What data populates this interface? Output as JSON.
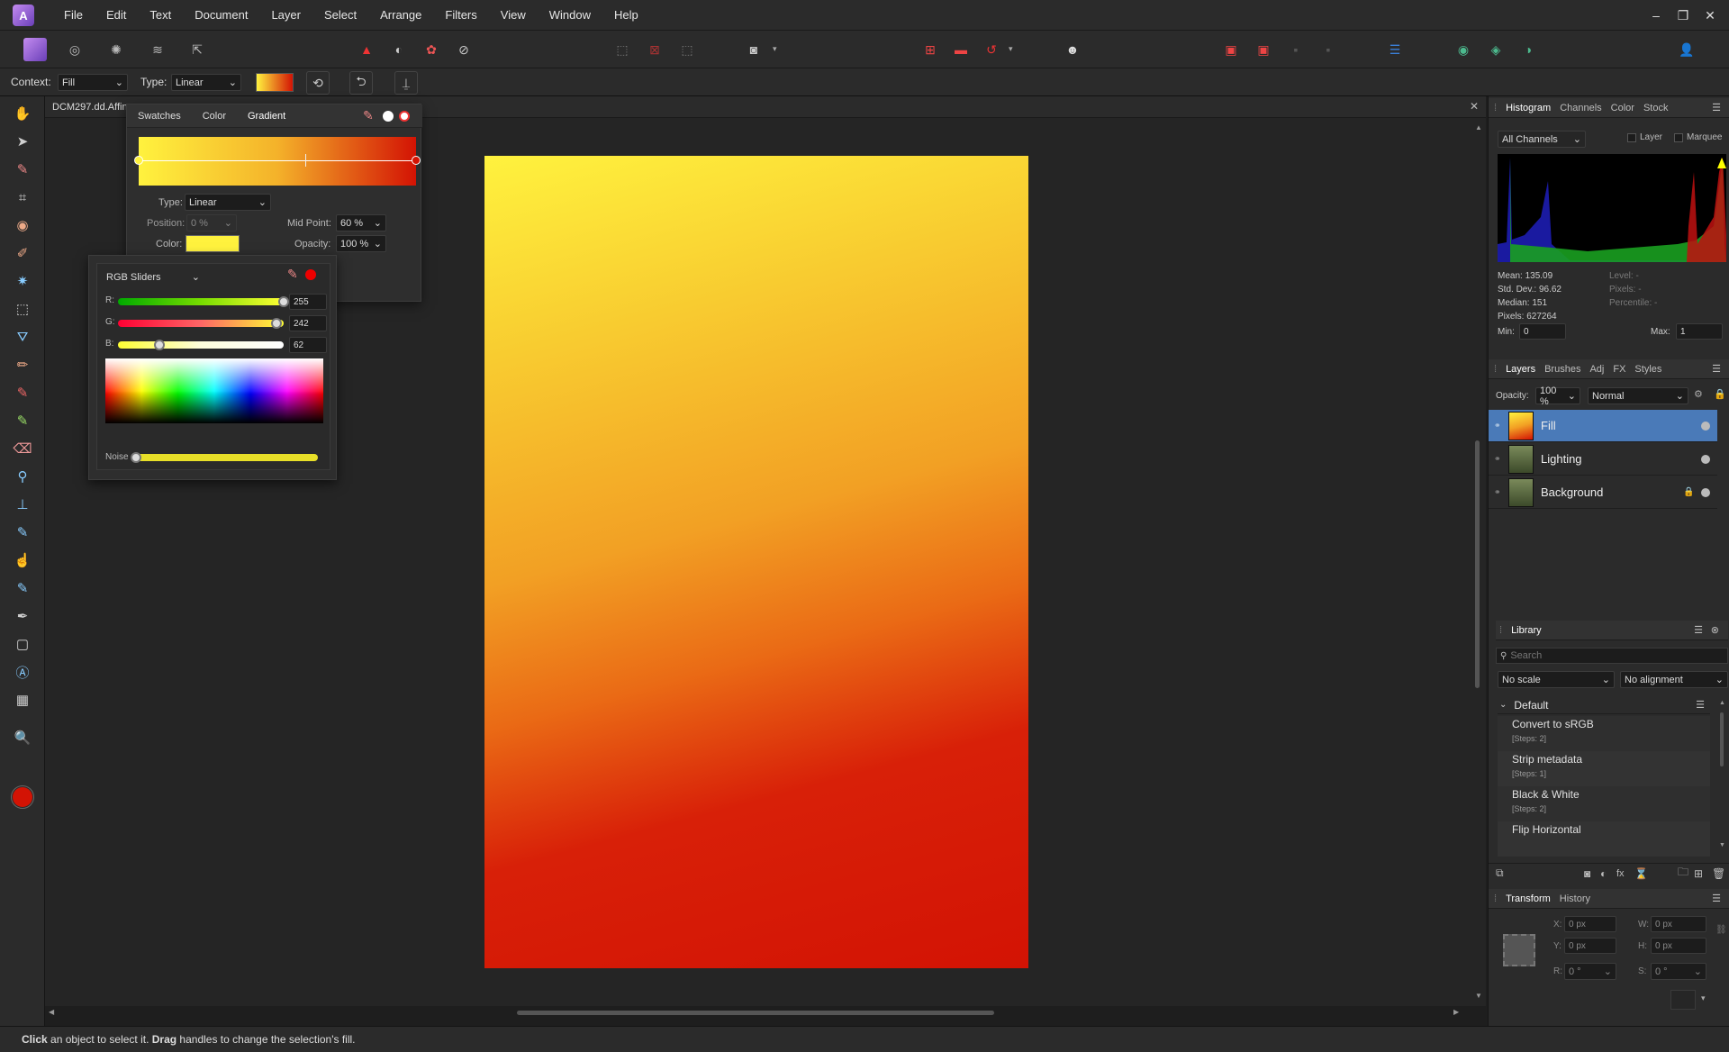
{
  "menubar": {
    "app_logo": "A",
    "items": [
      "File",
      "Edit",
      "Text",
      "Document",
      "Layer",
      "Select",
      "Arrange",
      "Filters",
      "View",
      "Window",
      "Help"
    ]
  },
  "context_bar": {
    "context_label": "Context:",
    "context_value": "Fill",
    "type_label": "Type:",
    "type_value": "Linear"
  },
  "document": {
    "tab_title": "DCM297.dd.Affin"
  },
  "gradient_popup": {
    "tabs": [
      "Swatches",
      "Color",
      "Gradient"
    ],
    "type_label": "Type:",
    "type_value": "Linear",
    "position_label": "Position:",
    "position_value": "0 %",
    "midpoint_label": "Mid Point:",
    "midpoint_value": "60 %",
    "color_label": "Color:",
    "opacity_label": "Opacity:",
    "opacity_value": "100 %",
    "color_swatch": "#fff23e"
  },
  "rgb_popup": {
    "mode": "RGB Sliders",
    "r_label": "R:",
    "r_value": "255",
    "g_label": "G:",
    "g_value": "242",
    "b_label": "B:",
    "b_value": "62",
    "noise_label": "Noise"
  },
  "histogram": {
    "tabs": [
      "Histogram",
      "Channels",
      "Color",
      "Stock"
    ],
    "channel": "All Channels",
    "layer_label": "Layer",
    "marquee_label": "Marquee",
    "mean": "Mean: 135.09",
    "stddev": "Std. Dev.: 96.62",
    "median": "Median: 151",
    "pixels": "Pixels: 627264",
    "level": "Level: -",
    "pixels_r": "Pixels: -",
    "percentile": "Percentile: -",
    "min_label": "Min:",
    "min_value": "0",
    "max_label": "Max:",
    "max_value": "1"
  },
  "layers": {
    "tabs": [
      "Layers",
      "Brushes",
      "Adj",
      "FX",
      "Styles"
    ],
    "opacity_label": "Opacity:",
    "opacity_value": "100 %",
    "blend_mode": "Normal",
    "items": [
      {
        "name": "Fill"
      },
      {
        "name": "Lighting"
      },
      {
        "name": "Background"
      }
    ]
  },
  "library": {
    "title": "Library",
    "search_placeholder": "Search",
    "scale": "No scale",
    "alignment": "No alignment",
    "group": "Default",
    "items": [
      {
        "name": "Convert to sRGB",
        "steps": "[Steps: 2]"
      },
      {
        "name": "Strip metadata",
        "steps": "[Steps: 1]"
      },
      {
        "name": "Black & White",
        "steps": "[Steps: 2]"
      },
      {
        "name": "Flip Horizontal",
        "steps": ""
      }
    ]
  },
  "transform": {
    "tabs": [
      "Transform",
      "History"
    ],
    "x_label": "X:",
    "x_value": "0 px",
    "y_label": "Y:",
    "y_value": "0 px",
    "w_label": "W:",
    "w_value": "0 px",
    "h_label": "H:",
    "h_value": "0 px",
    "r_label": "R:",
    "r_value": "0 °",
    "s_label": "S:",
    "s_value": "0 °"
  },
  "status": {
    "bold1": "Click",
    "text1": " an object to select it. ",
    "bold2": "Drag",
    "text2": " handles to change the selection's fill."
  },
  "colors": {
    "accent": "#4a90d9",
    "primary_color": "#d31304"
  }
}
